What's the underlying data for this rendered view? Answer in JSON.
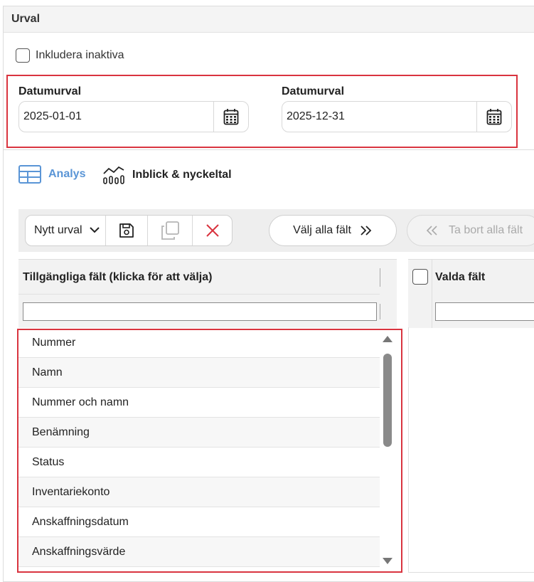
{
  "panel": {
    "title": "Urval"
  },
  "include_inactive": {
    "label": "Inkludera inaktiva",
    "checked": false
  },
  "date_from": {
    "label": "Datumurval",
    "value": "2025-01-01",
    "icon": "calendar-icon"
  },
  "date_to": {
    "label": "Datumurval",
    "value": "2025-12-31",
    "icon": "calendar-icon"
  },
  "tabs": [
    {
      "label": "Analys",
      "icon": "table-icon",
      "active": true
    },
    {
      "label": "Inblick & nyckeltal",
      "icon": "chart-icon",
      "active": false
    }
  ],
  "toolbar": {
    "selection_value": "Nytt urval",
    "save_icon": "save-icon",
    "copy_icon": "copy-icon",
    "delete_icon": "close-icon",
    "select_all_label": "Välj alla fält",
    "remove_all_label": "Ta bort alla fält"
  },
  "available_fields": {
    "header": "Tillgängliga fält (klicka för att välja)",
    "filter_value": "",
    "items": [
      "Nummer",
      "Namn",
      "Nummer och namn",
      "Benämning",
      "Status",
      "Inventariekonto",
      "Anskaffningsdatum",
      "Anskaffningsvärde"
    ]
  },
  "selected_fields": {
    "header": "Valda fält",
    "filter_value": ""
  },
  "colors": {
    "accent": "#5a95d6",
    "highlight": "#d9343f",
    "delete": "#d9343f"
  }
}
